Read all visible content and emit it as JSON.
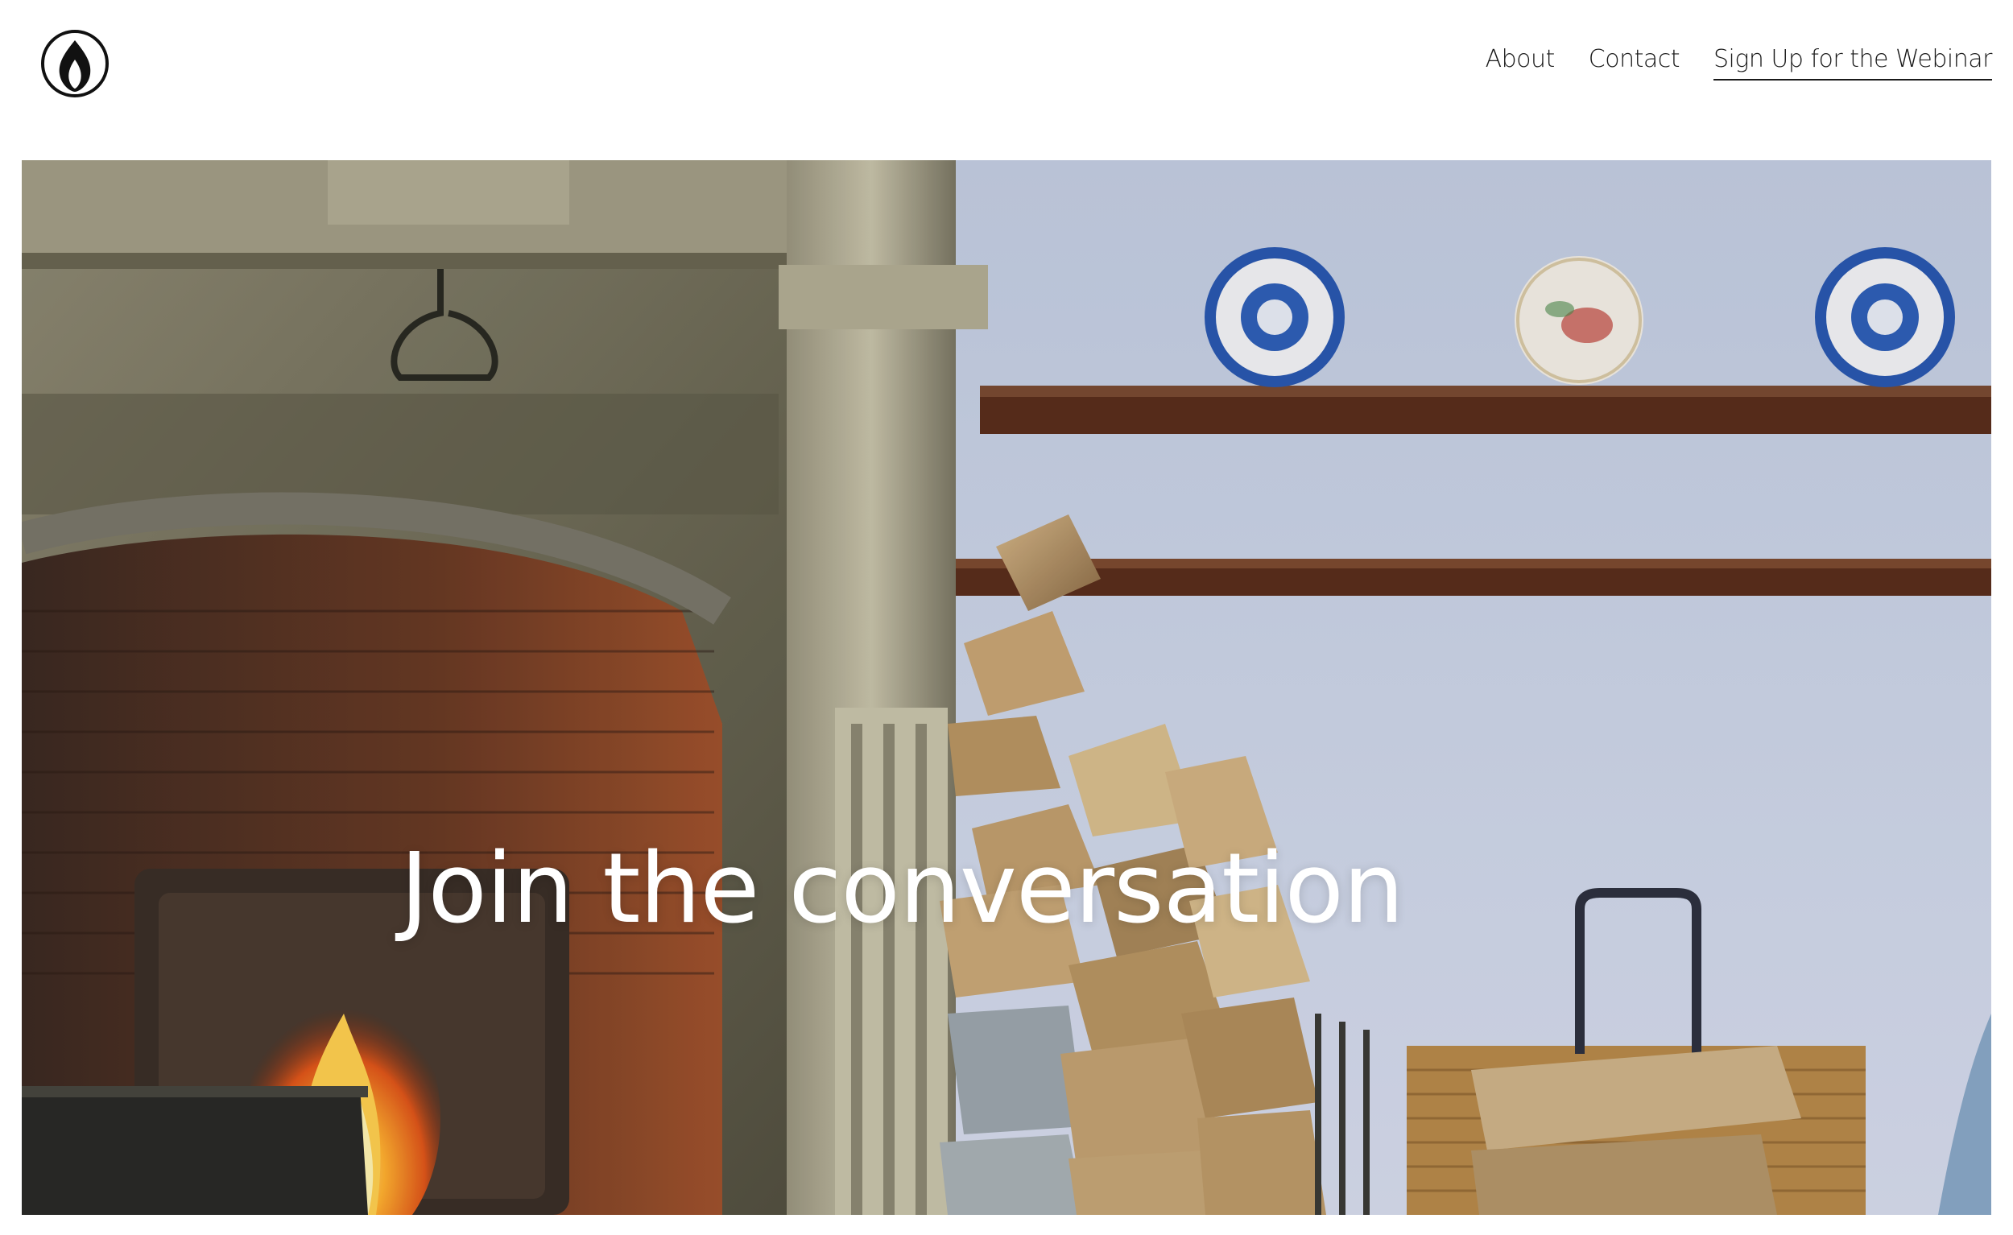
{
  "header": {
    "logo_icon": "flame-logo-icon",
    "nav": [
      {
        "label": "About",
        "active": false
      },
      {
        "label": "Contact",
        "active": false
      },
      {
        "label": "Sign Up for the Webinar",
        "active": true
      }
    ]
  },
  "hero": {
    "title": "Join the conversation",
    "image_subject": "fireplace-with-firewood-and-decorative-plates"
  },
  "colors": {
    "background": "#ffffff",
    "text": "#1a1a1a",
    "hero_title": "#ffffff",
    "wall_blue": "#c9d3e6",
    "fire": "#f08a1c"
  }
}
